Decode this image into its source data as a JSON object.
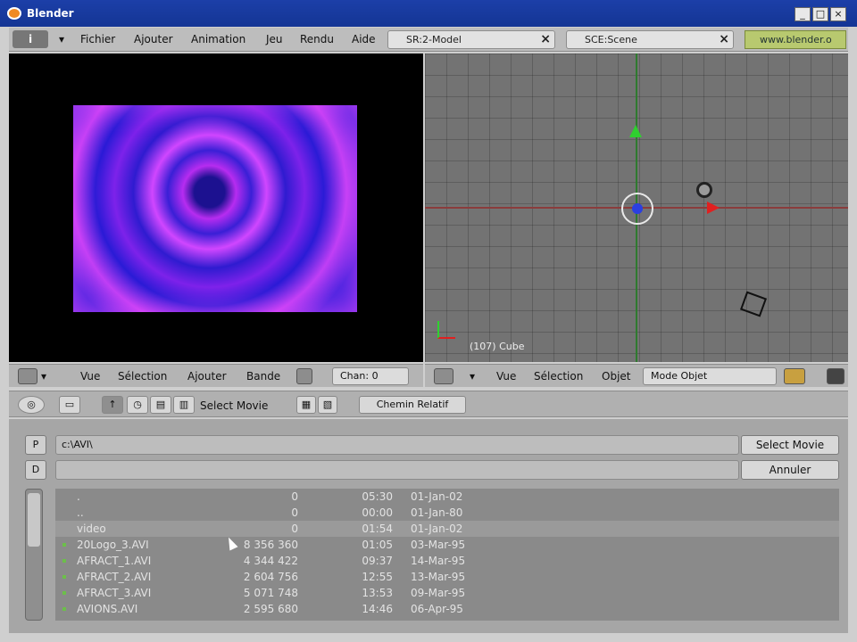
{
  "window": {
    "title": "Blender"
  },
  "menubar": {
    "items": [
      "Fichier",
      "Ajouter",
      "Animation",
      "Jeu",
      "Rendu",
      "Aide"
    ],
    "screen_combo": "SR:2-Model",
    "scene_combo": "SCE:Scene",
    "site": "www.blender.o"
  },
  "left_header": {
    "items": [
      "Vue",
      "Sélection",
      "Ajouter",
      "Bande"
    ],
    "chan": "Chan: 0"
  },
  "right_header": {
    "items": [
      "Vue",
      "Sélection",
      "Objet"
    ],
    "mode": "Mode Objet"
  },
  "viewport": {
    "label": "(107) Cube"
  },
  "file_browser": {
    "header_label": "Select Movie",
    "relative_button": "Chemin Relatif",
    "p_button": "P",
    "d_button": "D",
    "path_value": "c:\\AVI\\",
    "file_value": "",
    "select_button": "Select Movie",
    "cancel_button": "Annuler",
    "files": [
      {
        "name": ".",
        "size": "0",
        "time": "05:30",
        "date": "01-Jan-02"
      },
      {
        "name": "..",
        "size": "0",
        "time": "00:00",
        "date": "01-Jan-80"
      },
      {
        "name": "video",
        "size": "0",
        "time": "01:54",
        "date": "01-Jan-02"
      },
      {
        "name": "20Logo_3.AVI",
        "size": "8 356 360",
        "time": "01:05",
        "date": "03-Mar-95"
      },
      {
        "name": "AFRACT_1.AVI",
        "size": "4 344 422",
        "time": "09:37",
        "date": "14-Mar-95"
      },
      {
        "name": "AFRACT_2.AVI",
        "size": "2 604 756",
        "time": "12:55",
        "date": "13-Mar-95"
      },
      {
        "name": "AFRACT_3.AVI",
        "size": "5 071 748",
        "time": "13:53",
        "date": "09-Mar-95"
      },
      {
        "name": "AVIONS.AVI",
        "size": "2 595 680",
        "time": "14:46",
        "date": "06-Apr-95"
      }
    ]
  }
}
